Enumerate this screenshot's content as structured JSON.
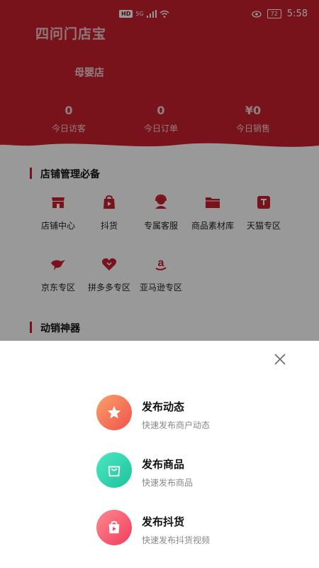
{
  "status_bar": {
    "network": "5G",
    "hd": "HD",
    "battery": "72",
    "time": "5:58"
  },
  "app": {
    "logo": "四问门店宝",
    "store_name": "母婴店"
  },
  "stats": [
    {
      "value": "0",
      "label": "今日访客"
    },
    {
      "value": "0",
      "label": "今日订单"
    },
    {
      "value": "¥0",
      "label": "今日销售"
    }
  ],
  "section1": {
    "title": "店铺管理必备",
    "items": [
      {
        "label": "店铺中心",
        "icon": "store-icon"
      },
      {
        "label": "抖货",
        "icon": "bag-play-icon"
      },
      {
        "label": "专属客服",
        "icon": "headset-icon"
      },
      {
        "label": "商品素材库",
        "icon": "folder-icon"
      },
      {
        "label": "天猫专区",
        "icon": "tmall-icon"
      },
      {
        "label": "京东专区",
        "icon": "jd-icon"
      },
      {
        "label": "拼多多专区",
        "icon": "pdd-icon"
      },
      {
        "label": "亚马逊专区",
        "icon": "amazon-icon"
      }
    ]
  },
  "section2": {
    "title": "动销神器"
  },
  "sheet": {
    "options": [
      {
        "title": "发布动态",
        "subtitle": "快速发布商户动态",
        "icon": "star-icon",
        "color": "#f57c55"
      },
      {
        "title": "发布商品",
        "subtitle": "快速发布商品",
        "icon": "shopping-bag-icon",
        "color": "#33d7b0"
      },
      {
        "title": "发布抖货",
        "subtitle": "快速发布抖货视频",
        "icon": "play-bag-icon",
        "color": "#f7526a"
      }
    ]
  },
  "colors": {
    "brand": "#c8202d"
  }
}
